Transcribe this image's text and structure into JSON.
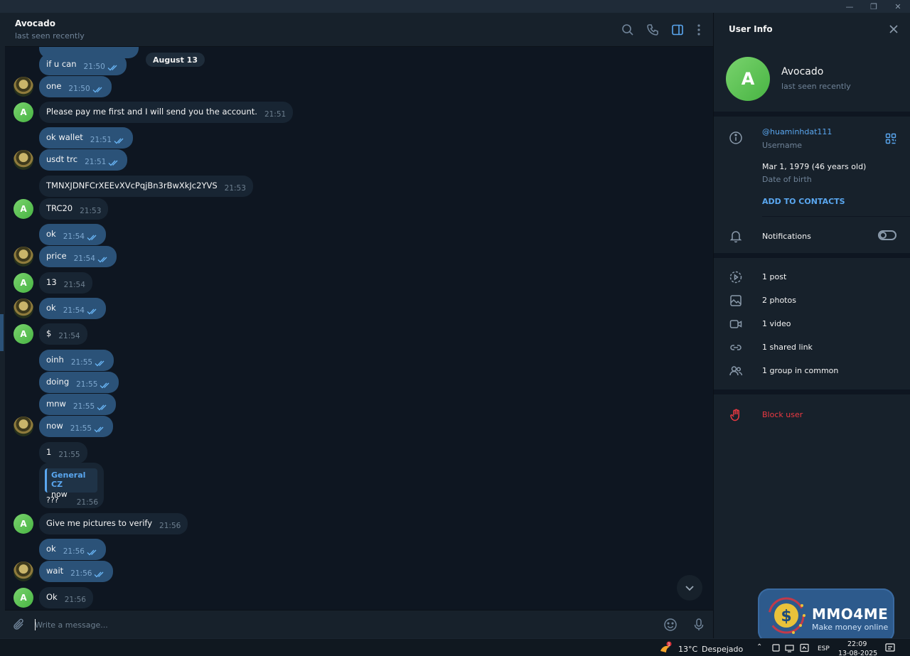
{
  "chat": {
    "title": "Avocado",
    "status": "last seen recently",
    "date_pill": "August 13",
    "composer_placeholder": "Write a message...",
    "avatar_letter": "A",
    "messages": [
      {
        "text": "if u can",
        "time": "21:50"
      },
      {
        "text": "one",
        "time": "21:50"
      },
      {
        "text": "Please pay me first and I will send you the account.",
        "time": "21:51"
      },
      {
        "text": "ok wallet",
        "time": "21:51"
      },
      {
        "text": "usdt trc",
        "time": "21:51"
      },
      {
        "text": "TMNXJDNFCrXEEvXVcPqjBn3rBwXkJc2YVS",
        "time": "21:53"
      },
      {
        "text": "TRC20",
        "time": "21:53"
      },
      {
        "text": "ok",
        "time": "21:54"
      },
      {
        "text": "price",
        "time": "21:54"
      },
      {
        "text": "13",
        "time": "21:54"
      },
      {
        "text": "ok",
        "time": "21:54"
      },
      {
        "text": "$",
        "time": "21:54"
      },
      {
        "text": "oinh",
        "time": "21:55"
      },
      {
        "text": "doing",
        "time": "21:55"
      },
      {
        "text": "mnw",
        "time": "21:55"
      },
      {
        "text": "now",
        "time": "21:55"
      },
      {
        "text": "1",
        "time": "21:55"
      },
      {
        "text": "Give me pictures to verify",
        "time": "21:56"
      },
      {
        "text": "ok",
        "time": "21:56"
      },
      {
        "text": "wait",
        "time": "21:56"
      },
      {
        "text": "Ok",
        "time": "21:56"
      }
    ],
    "reply": {
      "name": "General CZ",
      "quoted": "now",
      "text": "???",
      "time": "21:56"
    }
  },
  "side": {
    "title": "User Info",
    "name": "Avocado",
    "status": "last seen recently",
    "avatar_letter": "A",
    "username": "@huaminhdat111",
    "username_label": "Username",
    "dob": "Mar 1, 1979 (46 years old)",
    "dob_label": "Date of birth",
    "add_contacts": "ADD TO CONTACTS",
    "notifications": "Notifications",
    "notifications_on": false,
    "media": [
      "1 post",
      "2 photos",
      "1 video",
      "1 shared link",
      "1 group in common"
    ],
    "block": "Block user"
  },
  "watermark": {
    "title": "MMO4ME",
    "subtitle": "Make money online"
  },
  "taskbar": {
    "temp": "13°C",
    "condition": "Despejado",
    "lang": "ESP",
    "time": "22:09",
    "date": "13-08-2025",
    "weather_badge": "1"
  },
  "colors": {
    "bg": "#0e1621",
    "panel": "#17212b",
    "outgoing": "#2b5278",
    "incoming": "#182533",
    "accent": "#5aa7f0",
    "danger": "#ec3942",
    "avatar_green": "#5cc458"
  }
}
